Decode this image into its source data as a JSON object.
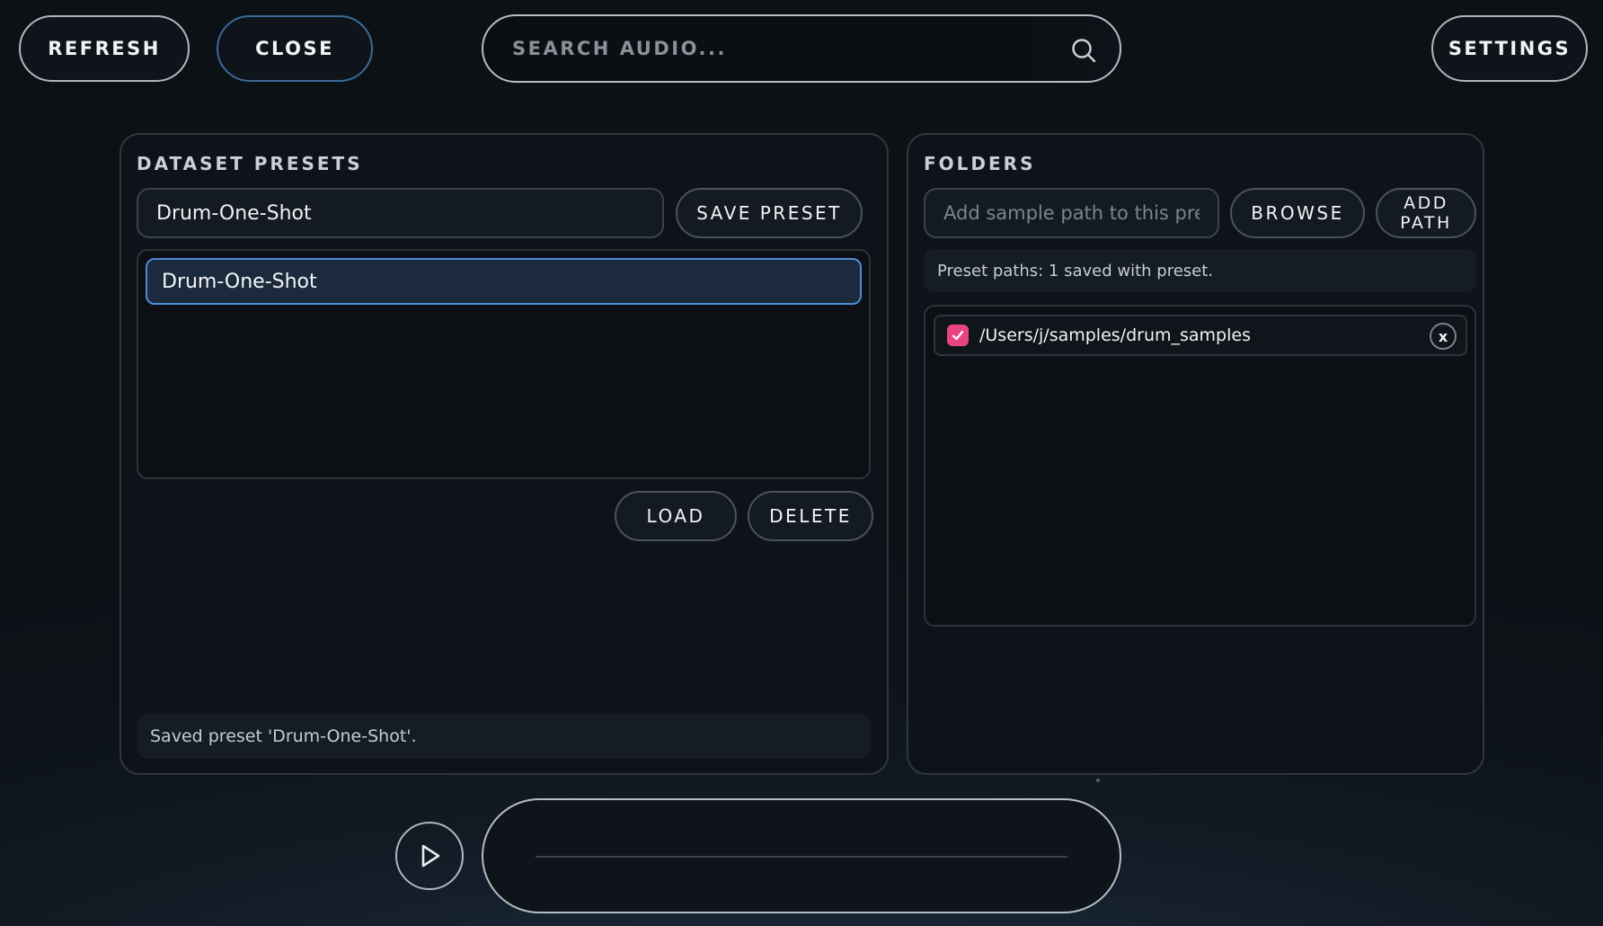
{
  "toolbar": {
    "refresh_label": "REFRESH",
    "close_label": "CLOSE",
    "settings_label": "SETTINGS",
    "search_placeholder": "SEARCH AUDIO..."
  },
  "presets": {
    "title": "DATASET PRESETS",
    "name_value": "Drum-One-Shot",
    "save_label": "SAVE PRESET",
    "items": [
      {
        "label": "Drum-One-Shot",
        "selected": true
      }
    ],
    "load_label": "LOAD",
    "delete_label": "DELETE",
    "status": "Saved preset 'Drum-One-Shot'."
  },
  "folders": {
    "title": "FOLDERS",
    "path_placeholder": "Add sample path to this preset",
    "browse_label": "BROWSE",
    "add_path_label": "ADD PATH",
    "info": "Preset paths: 1 saved with preset.",
    "paths": [
      {
        "path": "/Users/j/samples/drum_samples",
        "checked": true,
        "remove_label": "x"
      }
    ]
  },
  "player": {
    "icon": "play-icon"
  },
  "colors": {
    "accent": "#4f8bd6",
    "checkbox": "#e8457f",
    "close_border": "#3b6a9a"
  }
}
